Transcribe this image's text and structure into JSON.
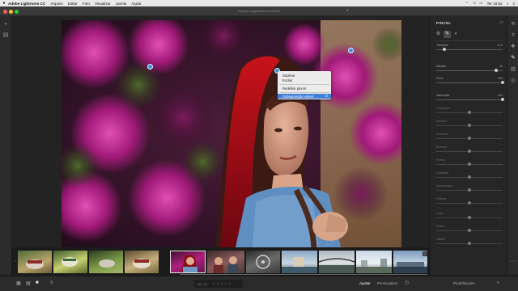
{
  "menubar": {
    "app_name": "Adobe Lightroom CC",
    "items": [
      "Arquivo",
      "Editar",
      "Foto",
      "Visualizar",
      "Janela",
      "Ajuda"
    ],
    "clock": "Ter 15:52"
  },
  "window": {
    "title": "Arquivo originalmente off-line"
  },
  "context_menu": {
    "items": [
      "Duplicar",
      "Excluir",
      "Redefinir pincel",
      "Sobreposição visível"
    ],
    "highlighted_shortcut": "O"
  },
  "panel": {
    "title": "PINCEL",
    "sliders": [
      {
        "label": "Tamanho",
        "value": "11.0",
        "level": 0.12
      },
      {
        "label": "Difusão",
        "value": "44",
        "level": 0.9
      },
      {
        "label": "Fluxo",
        "value": "100",
        "level": 1.0
      },
      {
        "label": "Saturação",
        "value": "-100",
        "level": 1.0
      },
      {
        "label": "Exposição",
        "value": "",
        "level": 0.5
      },
      {
        "label": "Realces",
        "value": "",
        "level": 0.5
      },
      {
        "label": "Sombras",
        "value": "",
        "level": 0.5
      },
      {
        "label": "Brancos",
        "value": "",
        "level": 0.5
      },
      {
        "label": "Pretos",
        "value": "",
        "level": 0.5
      },
      {
        "label": "Claridade",
        "value": "",
        "level": 0.5
      },
      {
        "label": "Desembaçar",
        "value": "",
        "level": 0.5
      },
      {
        "label": "Vinheta",
        "value": "",
        "level": 0.5
      },
      {
        "label": "Matiz",
        "value": "",
        "level": 0.5
      },
      {
        "label": "Ruído",
        "value": "",
        "level": 0.5
      },
      {
        "label": "Nitidez",
        "value": "",
        "level": 0.5
      }
    ]
  },
  "filmstrip": {
    "thumbnails": 11,
    "selected_index": 4
  },
  "bottombar": {
    "count": "20 / 22",
    "adjust_label": "Ajustar",
    "presets_label": "Predefinições",
    "prev_label": "Previsualizar"
  },
  "colors": {
    "accent": "#3f7fd8",
    "pin": "#3d8fe0"
  }
}
